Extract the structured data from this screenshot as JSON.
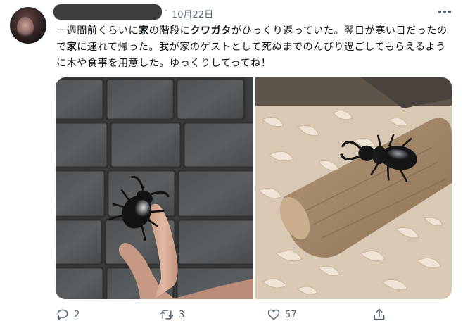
{
  "tweet": {
    "date": "10月22日",
    "separator": "·",
    "text_parts": [
      {
        "t": "一週間",
        "b": false
      },
      {
        "t": "前",
        "b": true
      },
      {
        "t": "くらいに",
        "b": false
      },
      {
        "t": "家",
        "b": true
      },
      {
        "t": "の階段に",
        "b": false
      },
      {
        "t": "クワガタ",
        "b": true
      },
      {
        "t": "がひっくり返っていた。翌日が寒い日だったので",
        "b": false
      },
      {
        "t": "家",
        "b": true
      },
      {
        "t": "に連れて帰った。我が家のゲストとして死ぬまでのんびり過ごしてもらえるように木や食事を用意した。ゆっくりしてってね！",
        "b": false
      }
    ],
    "media": [
      {
        "subject": "stag-beetle-on-finger"
      },
      {
        "subject": "stag-beetle-on-wood-shavings"
      }
    ]
  },
  "actions": {
    "reply_count": "2",
    "retweet_count": "3",
    "like_count": "57"
  },
  "colors": {
    "meta_gray": "#536471",
    "text": "#0f1419",
    "redaction": "#3c3c3c"
  },
  "icons": {
    "more": "more-icon",
    "reply": "reply-icon",
    "retweet": "retweet-icon",
    "like": "heart-icon",
    "share": "share-icon"
  }
}
